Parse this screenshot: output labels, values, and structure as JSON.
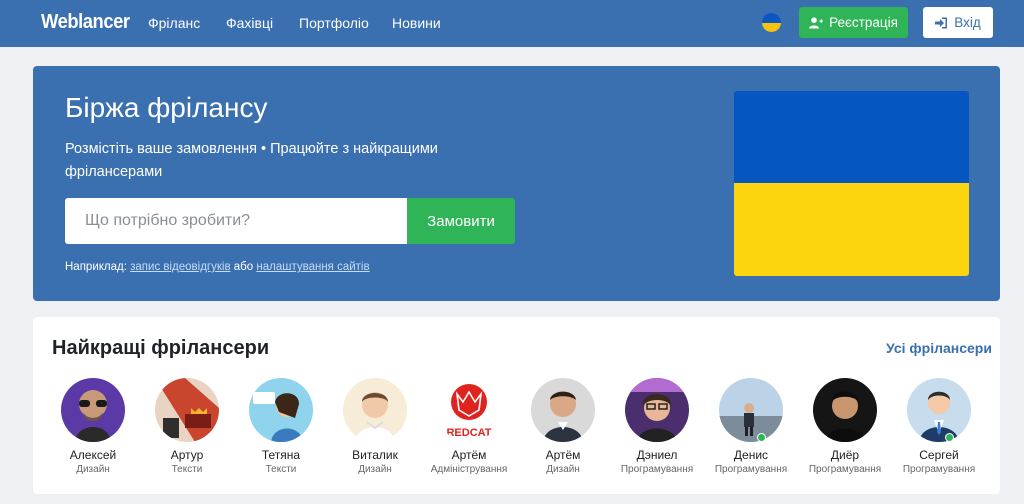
{
  "header": {
    "logo": "Weblancer",
    "nav": [
      "Фріланс",
      "Фахівці",
      "Портфоліо",
      "Новини"
    ],
    "register_label": "Реєстрація",
    "login_label": "Вхід"
  },
  "hero": {
    "title": "Біржа фрілансу",
    "subtitle": "Розмістіть ваше замовлення • Працюйте з найкращими фрілансерами",
    "search_placeholder": "Що потрібно зробити?",
    "order_label": "Замовити",
    "example_prefix": "Наприклад:",
    "example_link1": "запис відеовідгуків",
    "example_mid": "або",
    "example_link2": "налаштування сайтів"
  },
  "best": {
    "title": "Найкращі фрілансери",
    "all_link": "Усі фрілансери",
    "freelancers": [
      {
        "name": "Алексей",
        "role": "Дизайн",
        "online": false
      },
      {
        "name": "Артур",
        "role": "Тексти",
        "online": false
      },
      {
        "name": "Тетяна",
        "role": "Тексти",
        "online": false
      },
      {
        "name": "Виталик",
        "role": "Дизайн",
        "online": false
      },
      {
        "name": "Артём",
        "role": "Адміністрування",
        "online": false,
        "avatar_text": "REDCAT"
      },
      {
        "name": "Артём",
        "role": "Дизайн",
        "online": false
      },
      {
        "name": "Дэниел",
        "role": "Програмування",
        "online": false
      },
      {
        "name": "Денис",
        "role": "Програмування",
        "online": true
      },
      {
        "name": "Диёр",
        "role": "Програмування",
        "online": false
      },
      {
        "name": "Сергей",
        "role": "Програмування",
        "online": true
      }
    ]
  },
  "colors": {
    "primary": "#3a6fb0",
    "accent": "#2fb457",
    "flag_blue": "#0656c1",
    "flag_yellow": "#fdd50e"
  },
  "icons": [
    "ukraine-flag-icon",
    "user-plus-icon",
    "sign-in-icon"
  ]
}
